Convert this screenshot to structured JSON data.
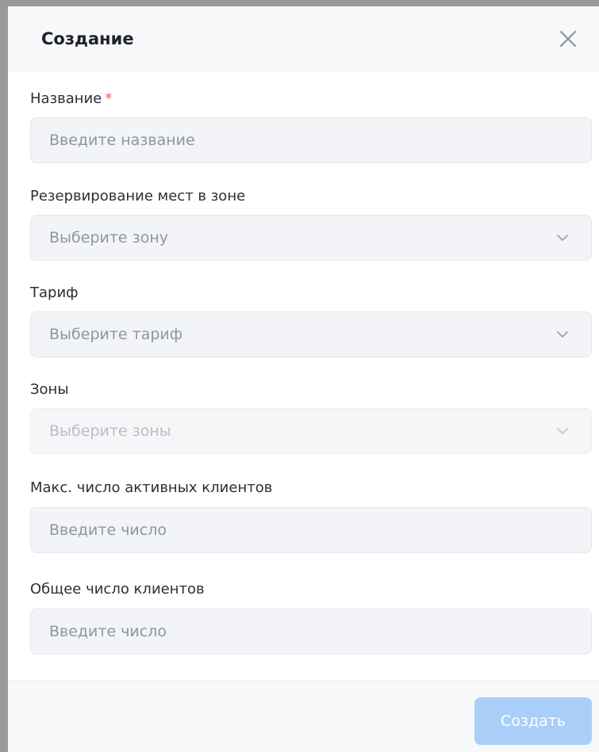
{
  "modal": {
    "title": "Создание",
    "create_label": "Создать"
  },
  "fields": {
    "name": {
      "label": "Название",
      "required_mark": "*",
      "placeholder": "Введите название"
    },
    "reservation_zone": {
      "label": "Резервирование мест в зоне",
      "placeholder": "Выберите зону"
    },
    "tariff": {
      "label": "Тариф",
      "placeholder": "Выберите тариф"
    },
    "zones": {
      "label": "Зоны",
      "placeholder": "Выберите зоны"
    },
    "max_active_clients": {
      "label": "Макс. число активных клиентов",
      "placeholder": "Введите число"
    },
    "total_clients": {
      "label": "Общее число клиентов",
      "placeholder": "Введите число"
    }
  },
  "icons": {
    "close": "close-icon",
    "chevron": "chevron-down-icon"
  },
  "colors": {
    "required": "#f5554a",
    "primary_disabled": "#a9cff8",
    "field_background": "#f2f4f7",
    "header_background": "#f7f8fa"
  }
}
